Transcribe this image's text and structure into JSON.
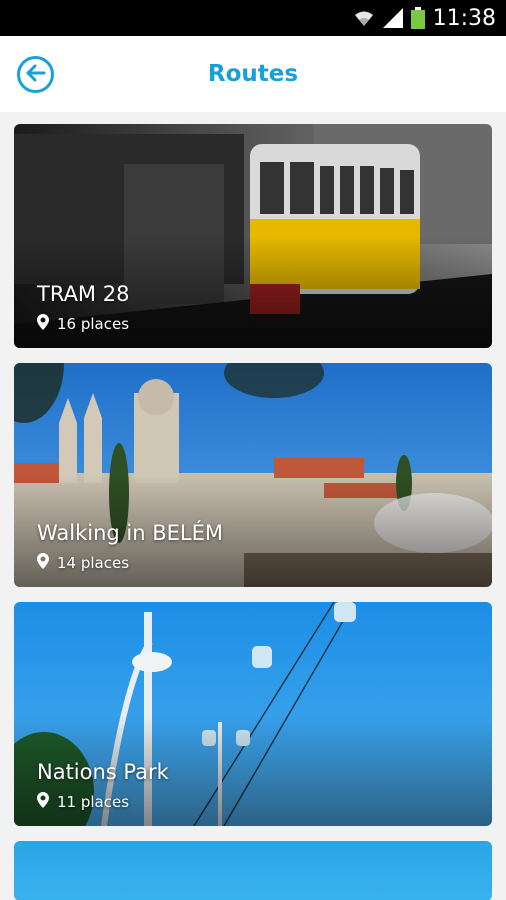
{
  "status_bar": {
    "time": "11:38"
  },
  "header": {
    "title": "Routes"
  },
  "routes": [
    {
      "title": "TRAM 28",
      "places": "16 places"
    },
    {
      "title": "Walking in BELÉM",
      "places": "14 places"
    },
    {
      "title": "Nations Park",
      "places": "11 places"
    }
  ],
  "icons": {
    "back": "arrow-left-circle-icon",
    "place": "map-pin-icon",
    "wifi": "wifi-icon",
    "signal": "signal-icon",
    "battery": "battery-icon"
  },
  "colors": {
    "accent": "#1aa0d9",
    "battery": "#7ac943"
  }
}
